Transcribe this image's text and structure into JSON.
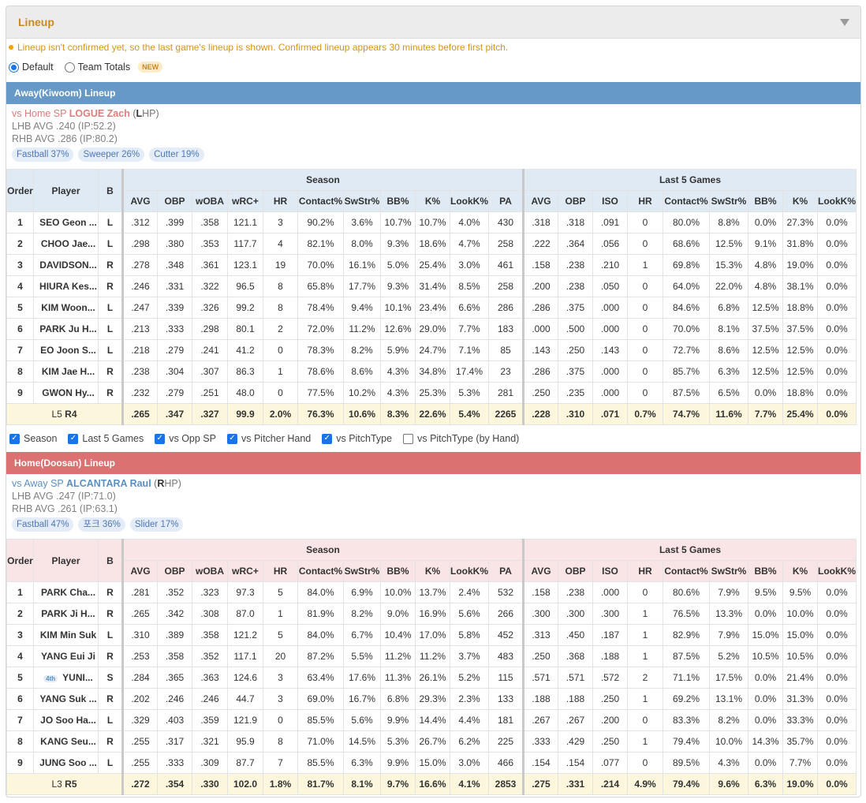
{
  "panel": {
    "title": "Lineup"
  },
  "notice": "Lineup isn't confirmed yet, so the last game's lineup is shown. Confirmed lineup appears 30 minutes before first pitch.",
  "view_options": [
    {
      "label": "Default",
      "selected": true
    },
    {
      "label": "Team Totals",
      "selected": false,
      "badge": "NEW"
    }
  ],
  "headers": {
    "order": "Order",
    "player": "Player",
    "bat": "B",
    "season": "Season",
    "last5": "Last 5 Games",
    "season_cols": [
      "AVG",
      "OBP",
      "wOBA",
      "wRC+",
      "HR",
      "Contact%",
      "SwStr%",
      "BB%",
      "K%",
      "LookK%",
      "PA"
    ],
    "last5_cols": [
      "AVG",
      "OBP",
      "ISO",
      "HR",
      "Contact%",
      "SwStr%",
      "BB%",
      "K%",
      "LookK%"
    ]
  },
  "away": {
    "title": "Away(Kiwoom) Lineup",
    "sp_prefix": "vs Home SP",
    "sp_name": "LOGUE Zach",
    "sp_hand_open": "(",
    "sp_hand_letter": "L",
    "sp_hand_rest": "HP)",
    "lhb": "LHB AVG .240 (IP:52.2)",
    "rhb": "RHB AVG .286 (IP:80.2)",
    "pitch_types": [
      "Fastball 37%",
      "Sweeper 26%",
      "Cutter 19%"
    ],
    "rows": [
      {
        "order": "1",
        "player": "SEO Geon ...",
        "bat": "L",
        "season": [
          ".312",
          ".399",
          ".358",
          "121.1",
          "3",
          "90.2%",
          "3.6%",
          "10.7%",
          "10.7%",
          "4.0%",
          "430"
        ],
        "last5": [
          ".318",
          ".318",
          ".091",
          "0",
          "80.0%",
          "8.8%",
          "0.0%",
          "27.3%",
          "0.0%"
        ]
      },
      {
        "order": "2",
        "player": "CHOO Jae...",
        "bat": "L",
        "season": [
          ".298",
          ".380",
          ".353",
          "117.7",
          "4",
          "82.1%",
          "8.0%",
          "9.3%",
          "18.6%",
          "4.7%",
          "258"
        ],
        "last5": [
          ".222",
          ".364",
          ".056",
          "0",
          "68.6%",
          "12.5%",
          "9.1%",
          "31.8%",
          "0.0%"
        ]
      },
      {
        "order": "3",
        "player": "DAVIDSON...",
        "bat": "R",
        "season": [
          ".278",
          ".348",
          ".361",
          "123.1",
          "19",
          "70.0%",
          "16.1%",
          "5.0%",
          "25.4%",
          "3.0%",
          "461"
        ],
        "last5": [
          ".158",
          ".238",
          ".210",
          "1",
          "69.8%",
          "15.3%",
          "4.8%",
          "19.0%",
          "0.0%"
        ]
      },
      {
        "order": "4",
        "player": "HIURA Kes...",
        "bat": "R",
        "season": [
          ".246",
          ".331",
          ".322",
          "96.5",
          "8",
          "65.8%",
          "17.7%",
          "9.3%",
          "31.4%",
          "8.5%",
          "258"
        ],
        "last5": [
          ".200",
          ".238",
          ".050",
          "0",
          "64.0%",
          "22.0%",
          "4.8%",
          "38.1%",
          "0.0%"
        ]
      },
      {
        "order": "5",
        "player": "KIM Woon...",
        "bat": "L",
        "season": [
          ".247",
          ".339",
          ".326",
          "99.2",
          "8",
          "78.4%",
          "9.4%",
          "10.1%",
          "23.4%",
          "6.6%",
          "286"
        ],
        "last5": [
          ".286",
          ".375",
          ".000",
          "0",
          "84.6%",
          "6.8%",
          "12.5%",
          "18.8%",
          "0.0%"
        ]
      },
      {
        "order": "6",
        "player": "PARK Ju H...",
        "bat": "L",
        "season": [
          ".213",
          ".333",
          ".298",
          "80.1",
          "2",
          "72.0%",
          "11.2%",
          "12.6%",
          "29.0%",
          "7.7%",
          "183"
        ],
        "last5": [
          ".000",
          ".500",
          ".000",
          "0",
          "70.0%",
          "8.1%",
          "37.5%",
          "37.5%",
          "0.0%"
        ]
      },
      {
        "order": "7",
        "player": "EO Joon S...",
        "bat": "L",
        "season": [
          ".218",
          ".279",
          ".241",
          "41.2",
          "0",
          "78.3%",
          "8.2%",
          "5.9%",
          "24.7%",
          "7.1%",
          "85"
        ],
        "last5": [
          ".143",
          ".250",
          ".143",
          "0",
          "72.7%",
          "8.6%",
          "12.5%",
          "12.5%",
          "0.0%"
        ]
      },
      {
        "order": "8",
        "player": "KIM Jae H...",
        "bat": "R",
        "season": [
          ".238",
          ".304",
          ".307",
          "86.3",
          "1",
          "78.6%",
          "8.6%",
          "4.3%",
          "34.8%",
          "17.4%",
          "23"
        ],
        "last5": [
          ".286",
          ".375",
          ".000",
          "0",
          "85.7%",
          "6.3%",
          "12.5%",
          "12.5%",
          "0.0%"
        ]
      },
      {
        "order": "9",
        "player": "GWON Hy...",
        "bat": "R",
        "season": [
          ".232",
          ".279",
          ".251",
          "48.0",
          "0",
          "77.5%",
          "10.2%",
          "4.3%",
          "25.3%",
          "5.3%",
          "281"
        ],
        "last5": [
          ".250",
          ".235",
          ".000",
          "0",
          "87.5%",
          "6.5%",
          "0.0%",
          "18.8%",
          "0.0%"
        ]
      }
    ],
    "total_label_pre": "L5 ",
    "total_label_post": "R4",
    "total_season": [
      ".265",
      ".347",
      ".327",
      "99.9",
      "2.0%",
      "76.3%",
      "10.6%",
      "8.3%",
      "22.6%",
      "5.4%",
      "2265"
    ],
    "total_season_color": [
      "r",
      "r",
      "r",
      "r",
      "g",
      "r",
      "r",
      "r",
      "r",
      "r",
      "k"
    ],
    "total_last5": [
      ".228",
      ".310",
      ".071",
      "0.7%",
      "74.7%",
      "11.6%",
      "7.7%",
      "25.4%",
      "0.0%"
    ],
    "total_last5_color": [
      "r",
      "r",
      "r",
      "r",
      "r",
      "r",
      "g",
      "r",
      "k"
    ]
  },
  "filters": [
    {
      "label": "Season",
      "checked": true
    },
    {
      "label": "Last 5 Games",
      "checked": true
    },
    {
      "label": "vs Opp SP",
      "checked": true
    },
    {
      "label": "vs Pitcher Hand",
      "checked": true
    },
    {
      "label": "vs PitchType",
      "checked": true
    },
    {
      "label": "vs PitchType (by Hand)",
      "checked": false
    }
  ],
  "home": {
    "title": "Home(Doosan) Lineup",
    "sp_prefix": "vs Away SP",
    "sp_name": "ALCANTARA Raul",
    "sp_hand_open": "(",
    "sp_hand_letter": "R",
    "sp_hand_rest": "HP)",
    "lhb": "LHB AVG .247 (IP:71.0)",
    "rhb": "RHB AVG .261 (IP:63.1)",
    "pitch_types": [
      "Fastball 47%",
      "포크 36%",
      "Slider 17%"
    ],
    "rows": [
      {
        "order": "1",
        "player": "PARK Cha...",
        "bat": "R",
        "season": [
          ".281",
          ".352",
          ".323",
          "97.3",
          "5",
          "84.0%",
          "6.9%",
          "10.0%",
          "13.7%",
          "2.4%",
          "532"
        ],
        "last5": [
          ".158",
          ".238",
          ".000",
          "0",
          "80.6%",
          "7.9%",
          "9.5%",
          "9.5%",
          "0.0%"
        ]
      },
      {
        "order": "2",
        "player": "PARK Ji H...",
        "bat": "R",
        "season": [
          ".265",
          ".342",
          ".308",
          "87.0",
          "1",
          "81.9%",
          "8.2%",
          "9.0%",
          "16.9%",
          "5.6%",
          "266"
        ],
        "last5": [
          ".300",
          ".300",
          ".300",
          "1",
          "76.5%",
          "13.3%",
          "0.0%",
          "10.0%",
          "0.0%"
        ]
      },
      {
        "order": "3",
        "player": "KIM Min Suk",
        "bat": "L",
        "season": [
          ".310",
          ".389",
          ".358",
          "121.2",
          "5",
          "84.0%",
          "6.7%",
          "10.4%",
          "17.0%",
          "5.8%",
          "452"
        ],
        "last5": [
          ".313",
          ".450",
          ".187",
          "1",
          "82.9%",
          "7.9%",
          "15.0%",
          "15.0%",
          "0.0%"
        ]
      },
      {
        "order": "4",
        "player": "YANG Eui Ji",
        "bat": "R",
        "season": [
          ".253",
          ".358",
          ".352",
          "117.1",
          "20",
          "87.2%",
          "5.5%",
          "11.2%",
          "11.2%",
          "3.7%",
          "483"
        ],
        "last5": [
          ".250",
          ".368",
          ".188",
          "1",
          "87.5%",
          "5.2%",
          "10.5%",
          "10.5%",
          "0.0%"
        ]
      },
      {
        "order": "5",
        "player": "YUNI...",
        "tag": "4th",
        "bat": "S",
        "season": [
          ".284",
          ".365",
          ".363",
          "124.6",
          "3",
          "63.4%",
          "17.6%",
          "11.3%",
          "26.1%",
          "5.2%",
          "115"
        ],
        "last5": [
          ".571",
          ".571",
          ".572",
          "2",
          "71.1%",
          "17.5%",
          "0.0%",
          "21.4%",
          "0.0%"
        ]
      },
      {
        "order": "6",
        "player": "YANG Suk ...",
        "bat": "R",
        "season": [
          ".202",
          ".246",
          ".246",
          "44.7",
          "3",
          "69.0%",
          "16.7%",
          "6.8%",
          "29.3%",
          "2.3%",
          "133"
        ],
        "last5": [
          ".188",
          ".188",
          ".250",
          "1",
          "69.2%",
          "13.1%",
          "0.0%",
          "31.3%",
          "0.0%"
        ]
      },
      {
        "order": "7",
        "player": "JO Soo Ha...",
        "bat": "L",
        "season": [
          ".329",
          ".403",
          ".359",
          "121.9",
          "0",
          "85.5%",
          "5.6%",
          "9.9%",
          "14.4%",
          "4.4%",
          "181"
        ],
        "last5": [
          ".267",
          ".267",
          ".200",
          "0",
          "83.3%",
          "8.2%",
          "0.0%",
          "33.3%",
          "0.0%"
        ]
      },
      {
        "order": "8",
        "player": "KANG Seu...",
        "bat": "R",
        "season": [
          ".255",
          ".317",
          ".321",
          "95.9",
          "8",
          "71.0%",
          "14.5%",
          "5.3%",
          "26.7%",
          "6.2%",
          "225"
        ],
        "last5": [
          ".333",
          ".429",
          ".250",
          "1",
          "79.4%",
          "10.0%",
          "14.3%",
          "35.7%",
          "0.0%"
        ]
      },
      {
        "order": "9",
        "player": "JUNG Soo ...",
        "bat": "L",
        "season": [
          ".255",
          ".333",
          ".309",
          "87.7",
          "7",
          "85.5%",
          "6.3%",
          "9.9%",
          "15.0%",
          "3.0%",
          "466"
        ],
        "last5": [
          ".154",
          ".154",
          ".077",
          "0",
          "89.5%",
          "4.3%",
          "0.0%",
          "7.7%",
          "0.0%"
        ]
      }
    ],
    "total_label_pre": "L3 ",
    "total_label_post": "R5",
    "total_season": [
      ".272",
      ".354",
      ".330",
      "102.0",
      "1.8%",
      "81.7%",
      "8.1%",
      "9.7%",
      "16.6%",
      "4.1%",
      "2853"
    ],
    "total_season_color": [
      "g",
      "g",
      "g",
      "g",
      "r",
      "g",
      "g",
      "g",
      "g",
      "g",
      "k"
    ],
    "total_last5": [
      ".275",
      ".331",
      ".214",
      "4.9%",
      "79.4%",
      "9.6%",
      "6.3%",
      "19.0%",
      "0.0%"
    ],
    "total_last5_color": [
      "g",
      "g",
      "g",
      "g",
      "g",
      "g",
      "r",
      "g",
      "k"
    ]
  }
}
